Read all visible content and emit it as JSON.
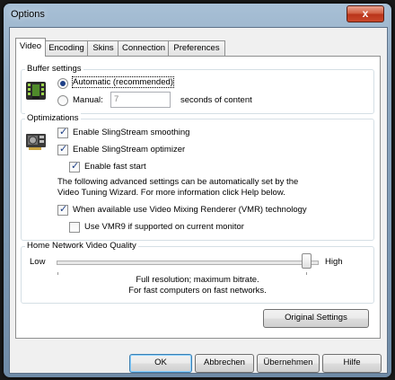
{
  "window": {
    "title": "Options",
    "close_label": "x"
  },
  "tabs": [
    {
      "label": "Video",
      "active": true
    },
    {
      "label": "Encoding",
      "active": false
    },
    {
      "label": "Skins",
      "active": false
    },
    {
      "label": "Connection",
      "active": false
    },
    {
      "label": "Preferences",
      "active": false
    }
  ],
  "buffer": {
    "group_label": "Buffer settings",
    "automatic_label": "Automatic (recommended)",
    "automatic_selected": true,
    "manual_label": "Manual:",
    "manual_selected": false,
    "manual_value": "7",
    "suffix": "seconds of content"
  },
  "optimizations": {
    "group_label": "Optimizations",
    "smoothing_label": "Enable SlingStream smoothing",
    "smoothing_checked": true,
    "optimizer_label": "Enable SlingStream optimizer",
    "optimizer_checked": true,
    "fast_start_label": "Enable fast start",
    "fast_start_checked": true,
    "info_line1": "The following advanced settings can be automatically set by the",
    "info_line2": "Video Tuning Wizard.  For more information click Help below.",
    "vmr_label": "When available use Video Mixing Renderer (VMR) technology",
    "vmr_checked": true,
    "vmr9_label": "Use VMR9 if supported on current monitor",
    "vmr9_checked": false
  },
  "quality": {
    "group_label": "Home Network Video Quality",
    "low_label": "Low",
    "high_label": "High",
    "level": 0.95,
    "desc_line1": "Full resolution; maximum bitrate.",
    "desc_line2": "For fast computers on fast networks."
  },
  "buttons": {
    "original_settings": "Original Settings",
    "ok": "OK",
    "cancel": "Abbrechen",
    "apply": "Übernehmen",
    "help": "Hilfe"
  },
  "colors": {
    "accent": "#1d3f86",
    "titlebar": "#8fa9c2",
    "close": "#c9482b"
  },
  "icons": {
    "buffer": "film-buffer-icon",
    "optimizations": "graphics-card-icon"
  }
}
